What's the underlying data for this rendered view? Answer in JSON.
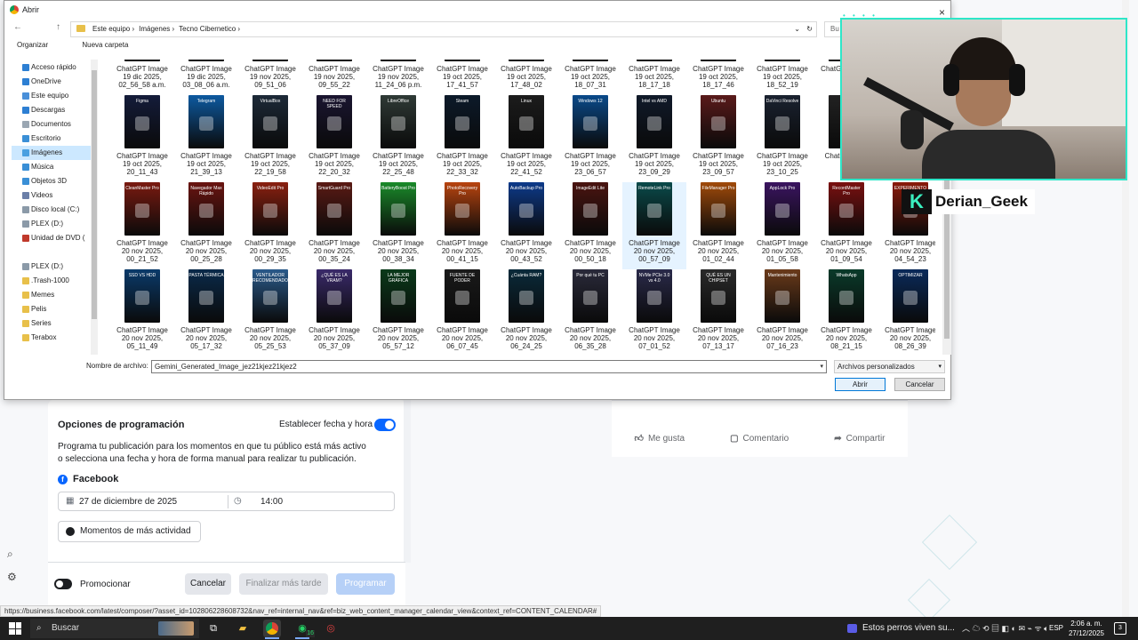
{
  "dialog": {
    "title": "Abrir",
    "close": "×",
    "breadcrumbs": [
      "Este equipo",
      "Imágenes",
      "Tecno Cibernetico"
    ],
    "search_stub": "Bu",
    "toolbar": {
      "organize": "Organizar",
      "new_folder": "Nueva carpeta"
    },
    "nav_items": [
      {
        "label": "Acceso rápido",
        "color": "#2d7fd3"
      },
      {
        "label": "OneDrive",
        "color": "#2d7fd3"
      },
      {
        "label": "Este equipo",
        "color": "#4a90d9"
      },
      {
        "label": "Descargas",
        "color": "#2d7fd3"
      },
      {
        "label": "Documentos",
        "color": "#9aa6b2"
      },
      {
        "label": "Escritorio",
        "color": "#3a8fd6"
      },
      {
        "label": "Imágenes",
        "color": "#4aa0e0",
        "selected": true
      },
      {
        "label": "Música",
        "color": "#3a8fd6"
      },
      {
        "label": "Objetos 3D",
        "color": "#3a8fd6"
      },
      {
        "label": "Videos",
        "color": "#6b7fa8"
      },
      {
        "label": "Disco local (C:)",
        "color": "#8b9aa8"
      },
      {
        "label": "PLEX (D:)",
        "color": "#8b9aa8"
      },
      {
        "label": "Unidad de DVD (",
        "color": "#c0392b"
      },
      {
        "label": "",
        "color": ""
      },
      {
        "label": "PLEX (D:)",
        "color": "#8b9aa8"
      },
      {
        "label": ".Trash-1000",
        "color": "#e8c04a"
      },
      {
        "label": "Memes",
        "color": "#e8c04a"
      },
      {
        "label": "Pelis",
        "color": "#e8c04a"
      },
      {
        "label": "Series",
        "color": "#e8c04a"
      },
      {
        "label": "Terabox",
        "color": "#e8c04a"
      }
    ],
    "rows": [
      [
        {
          "name": "ChatGPT Image",
          "date": "19 dic 2025,",
          "time": "02_56_58 a.m.",
          "color": "#3a3a3a"
        },
        {
          "name": "ChatGPT Image",
          "date": "19 dic 2025,",
          "time": "03_08_06 a.m.",
          "color": "#1f3a4a"
        },
        {
          "name": "ChatGPT Image",
          "date": "19 nov 2025,",
          "time": "09_51_06",
          "color": "#2a2a2a"
        },
        {
          "name": "ChatGPT Image",
          "date": "19 nov 2025,",
          "time": "09_55_22",
          "color": "#333"
        },
        {
          "name": "ChatGPT Image",
          "date": "19 nov 2025,",
          "time": "11_24_06 p.m.",
          "color": "#5a1010"
        },
        {
          "name": "ChatGPT Image",
          "date": "19 oct 2025,",
          "time": "17_41_57",
          "color": "#222"
        },
        {
          "name": "ChatGPT Image",
          "date": "19 oct 2025,",
          "time": "17_48_02",
          "color": "#222"
        },
        {
          "name": "ChatGPT Image",
          "date": "19 oct 2025,",
          "time": "18_07_31",
          "color": "#222"
        },
        {
          "name": "ChatGPT Image",
          "date": "19 oct 2025,",
          "time": "18_17_18",
          "color": "#222"
        },
        {
          "name": "ChatGPT Image",
          "date": "19 oct 2025,",
          "time": "18_17_46",
          "color": "#222"
        },
        {
          "name": "ChatGPT Image",
          "date": "19 oct 2025,",
          "time": "18_52_19",
          "color": "#222"
        },
        {
          "name": "ChatGPT Image",
          "date": "19",
          "time": "",
          "color": "#222"
        }
      ],
      [
        {
          "name": "ChatGPT Image",
          "date": "19 oct 2025,",
          "time": "20_11_43",
          "color": "#141c3a",
          "label": "Figma"
        },
        {
          "name": "ChatGPT Image",
          "date": "19 oct 2025,",
          "time": "21_39_13",
          "color": "#0d5aa0",
          "label": "Telegram"
        },
        {
          "name": "ChatGPT Image",
          "date": "19 oct 2025,",
          "time": "22_19_58",
          "color": "#1d2a38",
          "label": "VirtualBox"
        },
        {
          "name": "ChatGPT Image",
          "date": "19 oct 2025,",
          "time": "22_20_32",
          "color": "#1a1530",
          "label": "NEED FOR SPEED"
        },
        {
          "name": "ChatGPT Image",
          "date": "19 oct 2025,",
          "time": "22_25_48",
          "color": "#2f3a36",
          "label": "LibreOffice"
        },
        {
          "name": "ChatGPT Image",
          "date": "19 oct 2025,",
          "time": "22_33_32",
          "color": "#0c1a2a",
          "label": "Steam"
        },
        {
          "name": "ChatGPT Image",
          "date": "19 oct 2025,",
          "time": "22_41_52",
          "color": "#1c1c1c",
          "label": "Linux"
        },
        {
          "name": "ChatGPT Image",
          "date": "19 oct 2025,",
          "time": "23_06_57",
          "color": "#0a4a8a",
          "label": "Windows 12"
        },
        {
          "name": "ChatGPT Image",
          "date": "19 oct 2025,",
          "time": "23_09_29",
          "color": "#101a2a",
          "label": "Intel vs AMD"
        },
        {
          "name": "ChatGPT Image",
          "date": "19 oct 2025,",
          "time": "23_09_57",
          "color": "#5a1a1a",
          "label": "Ubuntu"
        },
        {
          "name": "ChatGPT Image",
          "date": "19 oct 2025,",
          "time": "23_10_25",
          "color": "#1a2230",
          "label": "DaVinci Resolve"
        },
        {
          "name": "ChatGPT Ima",
          "date": "19",
          "time": "",
          "color": "#222",
          "label": ""
        }
      ],
      [
        {
          "name": "ChatGPT Image",
          "date": "20 nov 2025,",
          "time": "00_21_52",
          "color": "#7a1a10",
          "label": "CleanMaster Pro"
        },
        {
          "name": "ChatGPT Image",
          "date": "20 nov 2025,",
          "time": "00_25_28",
          "color": "#6a1410",
          "label": "Navegador Max Rápido"
        },
        {
          "name": "ChatGPT Image",
          "date": "20 nov 2025,",
          "time": "00_29_35",
          "color": "#8a2010",
          "label": "VideoEdit Pro"
        },
        {
          "name": "ChatGPT Image",
          "date": "20 nov 2025,",
          "time": "00_35_24",
          "color": "#5a1a14",
          "label": "SmartGuard Pro"
        },
        {
          "name": "ChatGPT Image",
          "date": "20 nov 2025,",
          "time": "00_38_34",
          "color": "#1a8a2a",
          "label": "BatteryBoost Pro"
        },
        {
          "name": "ChatGPT Image",
          "date": "20 nov 2025,",
          "time": "00_41_15",
          "color": "#b8440f",
          "label": "PhotoRecovery Pro"
        },
        {
          "name": "ChatGPT Image",
          "date": "20 nov 2025,",
          "time": "00_43_52",
          "color": "#0d3a8a",
          "label": "AutoBackup Pro"
        },
        {
          "name": "ChatGPT Image",
          "date": "20 nov 2025,",
          "time": "00_50_18",
          "color": "#4a1410",
          "label": "ImageEdit Lite"
        },
        {
          "name": "ChatGPT Image",
          "date": "20 nov 2025,",
          "time": "00_57_09",
          "color": "#0a4a4a",
          "label": "RemoteLink Pro",
          "hover": true
        },
        {
          "name": "ChatGPT Image",
          "date": "20 nov 2025,",
          "time": "01_02_44",
          "color": "#a04a0a",
          "label": "FileManager Pro"
        },
        {
          "name": "ChatGPT Image",
          "date": "20 nov 2025,",
          "time": "01_05_58",
          "color": "#3a1460",
          "label": "AppLock Pro"
        },
        {
          "name": "ChatGPT Image",
          "date": "20 nov 2025,",
          "time": "01_09_54",
          "color": "#7a1010",
          "label": "RecordMaster Pro"
        },
        {
          "name": "ChatGPT Image",
          "date": "20 nov 2025,",
          "time": "04_54_23",
          "color": "#8a1a0a",
          "label": "EXPERIMENTO"
        }
      ],
      [
        {
          "name": "ChatGPT Image",
          "date": "20 nov 2025,",
          "time": "05_11_49",
          "color": "#0a3a6a",
          "label": "SSD VS HDD"
        },
        {
          "name": "ChatGPT Image",
          "date": "20 nov 2025,",
          "time": "05_17_32",
          "color": "#0a2a4a",
          "label": "PASTA TÉRMICA"
        },
        {
          "name": "ChatGPT Image",
          "date": "20 nov 2025,",
          "time": "05_25_53",
          "color": "#2a5a8a",
          "label": "VENTILADOR RECOMENDADO"
        },
        {
          "name": "ChatGPT Image",
          "date": "20 nov 2025,",
          "time": "05_37_09",
          "color": "#3a2a6a",
          "label": "¿QUÉ ES LA VRAM?"
        },
        {
          "name": "ChatGPT Image",
          "date": "20 nov 2025,",
          "time": "05_57_12",
          "color": "#0a3a1a",
          "label": "LA MEJOR GRÁFICA"
        },
        {
          "name": "ChatGPT Image",
          "date": "20 nov 2025,",
          "time": "06_07_45",
          "color": "#1a1a1a",
          "label": "FUENTE DE PODER"
        },
        {
          "name": "ChatGPT Image",
          "date": "20 nov 2025,",
          "time": "06_24_25",
          "color": "#0a2a3a",
          "label": "¿Cuánta RAM?"
        },
        {
          "name": "ChatGPT Image",
          "date": "20 nov 2025,",
          "time": "06_35_28",
          "color": "#2a2a3a",
          "label": "Por qué tu PC"
        },
        {
          "name": "ChatGPT Image",
          "date": "20 nov 2025,",
          "time": "07_01_52",
          "color": "#2a2a4a",
          "label": "NVMe PCIe 3.0 vs 4.0"
        },
        {
          "name": "ChatGPT Image",
          "date": "20 nov 2025,",
          "time": "07_13_17",
          "color": "#2a2a2a",
          "label": "QUÉ ES UN CHIPSET"
        },
        {
          "name": "ChatGPT Image",
          "date": "20 nov 2025,",
          "time": "07_16_23",
          "color": "#6a3a1a",
          "label": "Mantenimiento"
        },
        {
          "name": "ChatGPT Image",
          "date": "20 nov 2025,",
          "time": "08_21_15",
          "color": "#0a3a2a",
          "label": "WhatsApp"
        },
        {
          "name": "ChatGPT Image",
          "date": "20 nov 2025,",
          "time": "08_26_39",
          "color": "#0a2a5a",
          "label": "OPTIMIZAR"
        }
      ]
    ],
    "filename_label": "Nombre de archivo:",
    "filename_value": "Gemini_Generated_Image_jez21kjez21kjez2",
    "filetype": "Archivos personalizados",
    "open_button": "Abrir",
    "cancel_button": "Cancelar"
  },
  "schedule": {
    "title": "Opciones de programación",
    "toggle_label": "Establecer fecha y hora",
    "description": "Programa tu publicación para los momentos en que tu público está más activo o selecciona una fecha y hora de forma manual para realizar tu publicación.",
    "platform": "Facebook",
    "date": "27 de diciembre de 2025",
    "time": "14:00",
    "moments_button": "Momentos de más actividad",
    "promote_label": "Promocionar",
    "cancel_button": "Cancelar",
    "later_button": "Finalizar más tarde",
    "program_button": "Programar"
  },
  "post_card": {
    "like": "Me gusta",
    "comment": "Comentario",
    "share": "Compartir"
  },
  "status_url": "https://business.facebook.com/latest/composer/?asset_id=102806228608732&nav_ref=internal_nav&ref=biz_web_content_manager_calendar_view&context_ref=CONTENT_CALENDAR#",
  "webcam": {
    "name_tag": "Derian_Geek",
    "logo_letter": "K"
  },
  "taskbar": {
    "search": "Buscar",
    "whatsapp_badge": "16",
    "news": "Estos perros viven su...",
    "language": "ESP",
    "time": "2:06 a. m.",
    "date": "27/12/2025"
  }
}
